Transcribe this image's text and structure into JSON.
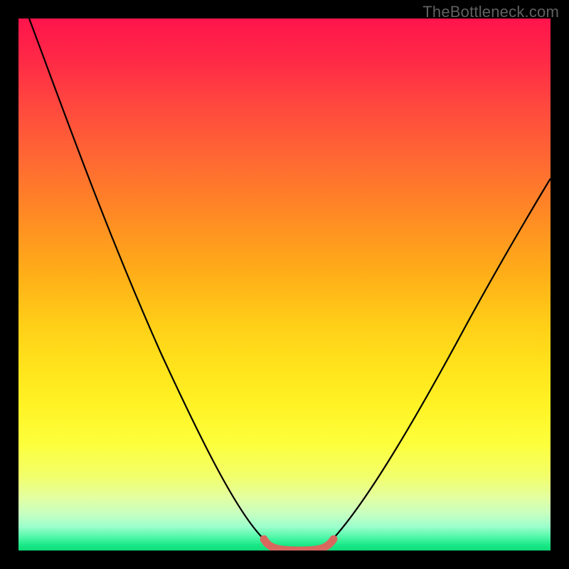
{
  "watermark": "TheBottleneck.com",
  "chart_data": {
    "type": "line",
    "title": "",
    "xlabel": "",
    "ylabel": "",
    "xlim": [
      0,
      100
    ],
    "ylim": [
      0,
      100
    ],
    "series": [
      {
        "name": "bottleneck-curve",
        "x": [
          10,
          15,
          20,
          25,
          30,
          35,
          40,
          44,
          47,
          50,
          52,
          55,
          58,
          60,
          65,
          70,
          75,
          80,
          85,
          90,
          95,
          100
        ],
        "values": [
          100,
          90,
          79,
          68,
          57,
          45,
          34,
          23,
          13,
          5,
          1,
          0,
          0,
          1,
          7,
          15,
          23,
          31,
          39,
          47,
          54,
          61
        ]
      },
      {
        "name": "flat-zone-highlight",
        "x": [
          49.5,
          52,
          56,
          59.5
        ],
        "values": [
          2,
          0,
          0,
          2
        ]
      }
    ],
    "background_gradient": {
      "top": "#ff144c",
      "mid_upper": "#ff8a24",
      "mid": "#ffe41c",
      "mid_lower": "#fdff3c",
      "bottom": "#10dc7a"
    },
    "highlight_color": "#d8685e",
    "curve_color": "#000000"
  }
}
